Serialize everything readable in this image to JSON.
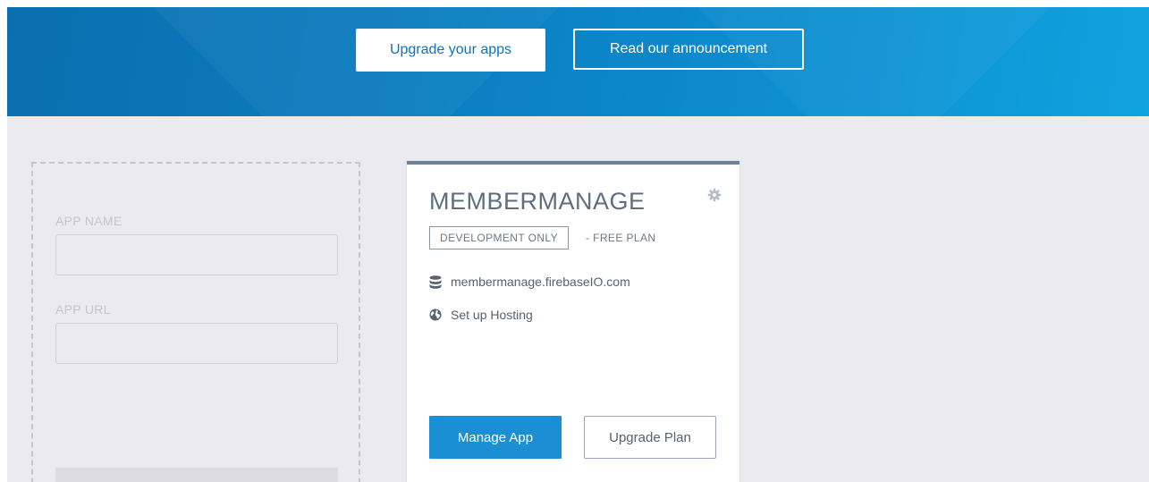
{
  "banner": {
    "upgrade_button_label": "Upgrade your apps",
    "announcement_button_label": "Read our announcement"
  },
  "new_app_form": {
    "app_name_label": "APP NAME",
    "app_name_value": "",
    "app_url_label": "APP URL",
    "app_url_value": ""
  },
  "app_card": {
    "title": "MEMBERMANAGE",
    "plan_badge": "DEVELOPMENT ONLY",
    "plan_suffix": "- FREE PLAN",
    "database_url": "membermanage.firebaseIO.com",
    "hosting_link": "Set up Hosting",
    "manage_button_label": "Manage App",
    "upgrade_plan_button_label": "Upgrade Plan",
    "icons": [
      "gear-icon",
      "database-icon",
      "globe-icon"
    ]
  },
  "colors": {
    "banner_start": "#0a6fae",
    "banner_end": "#10a3df",
    "primary_button": "#1b8fd3",
    "card_accent": "#6b8198",
    "page_background": "#ebebef"
  }
}
